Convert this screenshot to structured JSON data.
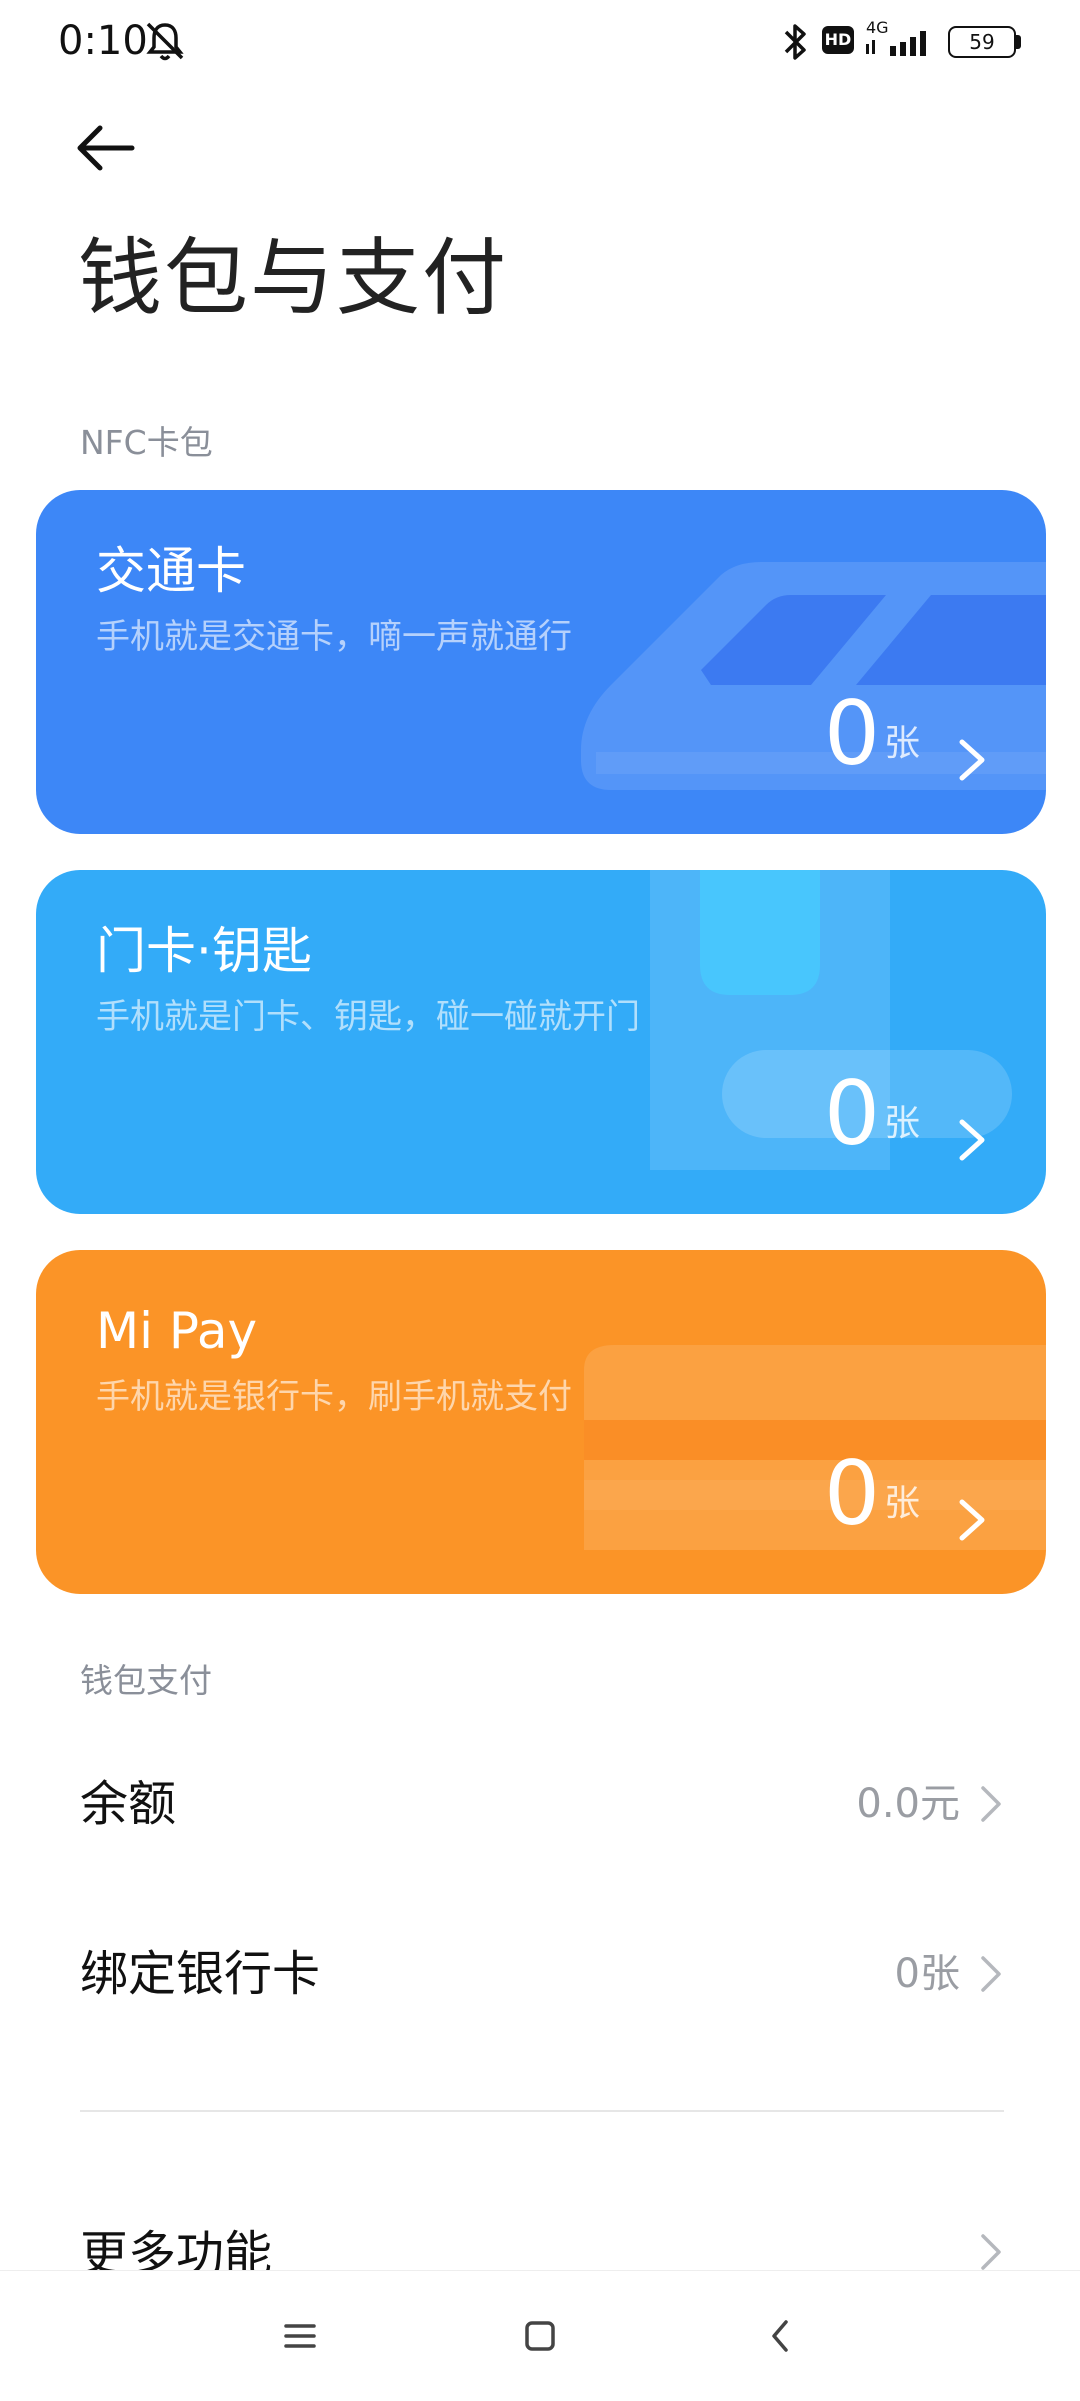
{
  "status_bar": {
    "time": "0:10",
    "network": "4G",
    "hd_badge": "HD",
    "battery": "59"
  },
  "header": {
    "title": "钱包与支付"
  },
  "sections": {
    "nfc_label": "NFC卡包",
    "wallet_label": "钱包支付"
  },
  "cards": [
    {
      "title": "交通卡",
      "subtitle": "手机就是交通卡，嘀一声就通行",
      "count": "0",
      "unit": "张",
      "color": "#3d87f7"
    },
    {
      "title": "门卡·钥匙",
      "subtitle": "手机就是门卡、钥匙，碰一碰就开门",
      "count": "0",
      "unit": "张",
      "color": "#33abf8"
    },
    {
      "title": "Mi Pay",
      "subtitle": "手机就是银行卡，刷手机就支付",
      "count": "0",
      "unit": "张",
      "color": "#fb9427"
    }
  ],
  "list": {
    "balance": {
      "label": "余额",
      "value": "0.0元"
    },
    "bind_card": {
      "label": "绑定银行卡",
      "value": "0张"
    },
    "more": {
      "label": "更多功能"
    }
  },
  "icons": {
    "back": "back-arrow-icon",
    "mute": "bell-muted-icon",
    "bluetooth": "bluetooth-icon",
    "signal": "signal-icon",
    "battery": "battery-icon",
    "chevron": "chevron-right-icon",
    "nav_menu": "menu-icon",
    "nav_home": "home-icon",
    "nav_back": "nav-back-icon"
  }
}
